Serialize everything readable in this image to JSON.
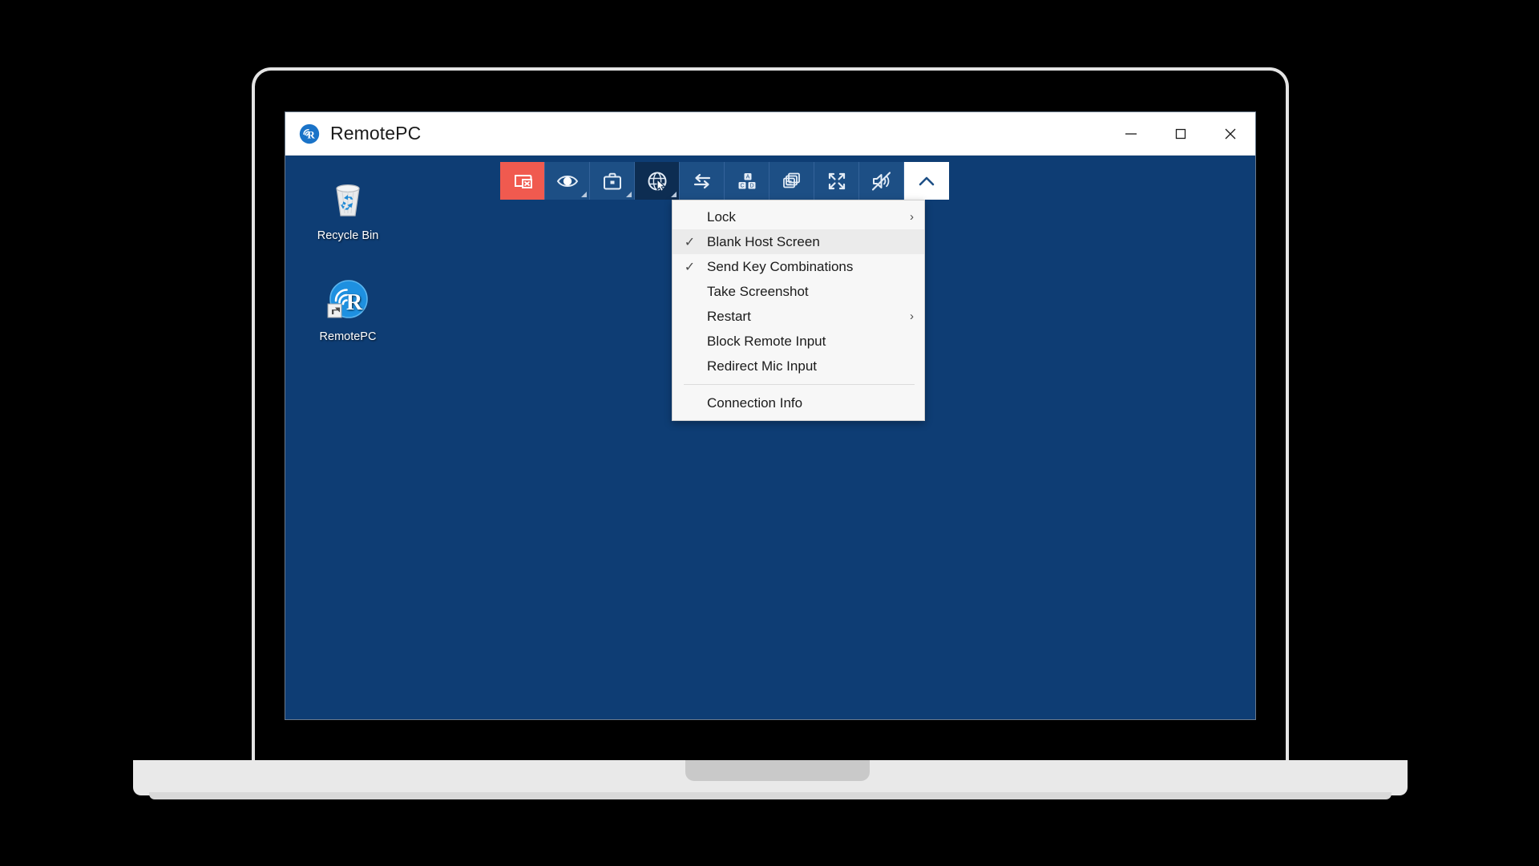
{
  "window": {
    "title": "RemotePC",
    "logo_icon": "remotepc-logo-icon",
    "controls": [
      {
        "name": "minimize-button",
        "icon": "minimize-icon",
        "label": "—"
      },
      {
        "name": "maximize-button",
        "icon": "maximize-icon",
        "label": "☐"
      },
      {
        "name": "close-button",
        "icon": "close-icon",
        "label": "✕"
      }
    ]
  },
  "desktop": {
    "background_color": "#0e3d74",
    "icons": [
      {
        "name": "recycle-bin",
        "label": "Recycle Bin",
        "icon": "recycle-bin-icon"
      },
      {
        "name": "remotepc-shortcut",
        "label": "RemotePC",
        "icon": "remotepc-shortcut-icon"
      }
    ]
  },
  "toolbar": {
    "buttons": [
      {
        "name": "disconnect-button",
        "icon": "monitor-disconnect-icon",
        "style": "danger",
        "caret": false,
        "title": "Disconnect"
      },
      {
        "name": "view-button",
        "icon": "eye-icon",
        "style": "normal",
        "caret": true,
        "title": "View"
      },
      {
        "name": "file-transfer-button",
        "icon": "briefcase-icon",
        "style": "normal",
        "caret": true,
        "title": "File Transfer"
      },
      {
        "name": "tools-button",
        "icon": "globe-cursor-icon",
        "style": "active",
        "caret": true,
        "title": "Tools"
      },
      {
        "name": "switch-button",
        "icon": "swap-arrows-icon",
        "style": "normal",
        "caret": false,
        "title": "Switch"
      },
      {
        "name": "keyboard-blocks-button",
        "icon": "keyboard-blocks-icon",
        "style": "normal",
        "caret": false,
        "title": "Keyboard"
      },
      {
        "name": "multi-monitor-button",
        "icon": "multi-monitor-icon",
        "style": "normal",
        "caret": false,
        "title": "Monitors"
      },
      {
        "name": "fullscreen-button",
        "icon": "fullscreen-icon",
        "style": "normal",
        "caret": false,
        "title": "Full Screen"
      },
      {
        "name": "mute-button",
        "icon": "speaker-muted-icon",
        "style": "normal",
        "caret": false,
        "title": "Mute"
      },
      {
        "name": "collapse-toolbar-button",
        "icon": "chevron-up-icon",
        "style": "light",
        "caret": false,
        "title": "Collapse"
      }
    ]
  },
  "context_menu": {
    "items": [
      {
        "name": "menu-item-lock",
        "label": "Lock",
        "checked": false,
        "submenu": true,
        "selected": false
      },
      {
        "name": "menu-item-blank-host-screen",
        "label": "Blank Host Screen",
        "checked": true,
        "submenu": false,
        "selected": true
      },
      {
        "name": "menu-item-send-key-combinations",
        "label": "Send Key Combinations",
        "checked": true,
        "submenu": false,
        "selected": false
      },
      {
        "name": "menu-item-take-screenshot",
        "label": "Take Screenshot",
        "checked": false,
        "submenu": false,
        "selected": false
      },
      {
        "name": "menu-item-restart",
        "label": "Restart",
        "checked": false,
        "submenu": true,
        "selected": false
      },
      {
        "name": "menu-item-block-remote-input",
        "label": "Block Remote Input",
        "checked": false,
        "submenu": false,
        "selected": false
      },
      {
        "name": "menu-item-redirect-mic-input",
        "label": "Redirect Mic Input",
        "checked": false,
        "submenu": false,
        "selected": false
      },
      {
        "name": "menu-separator",
        "label": "",
        "separator": true
      },
      {
        "name": "menu-item-connection-info",
        "label": "Connection Info",
        "checked": false,
        "submenu": false,
        "selected": false
      }
    ],
    "check_glyph": "✓",
    "submenu_glyph": "›"
  },
  "colors": {
    "accent_blue": "#1d4f85",
    "desktop_blue": "#0e3d74",
    "danger_red": "#f05a4f",
    "active_dark": "#0d2d52",
    "frame_gray": "#e4e4e4"
  }
}
